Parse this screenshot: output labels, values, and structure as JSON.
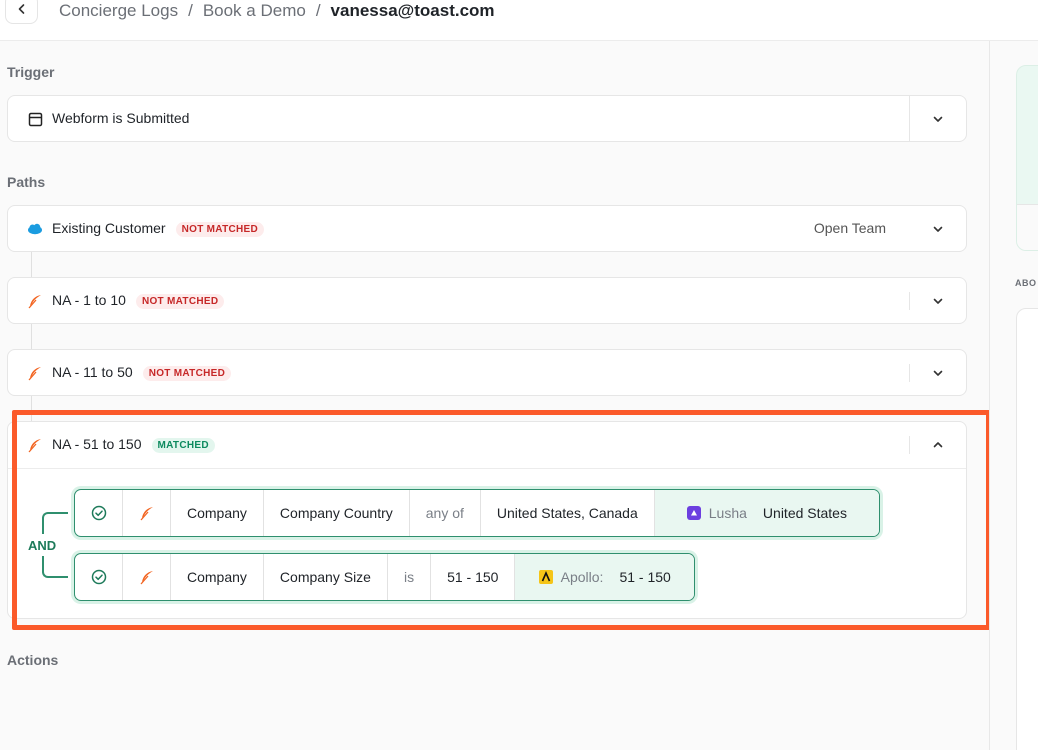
{
  "breadcrumb": {
    "items": [
      "Concierge Logs",
      "Book a Demo"
    ],
    "separator": "/",
    "current": "vanessa@toast.com"
  },
  "trigger": {
    "section_label": "Trigger",
    "title": "Webform is Submitted"
  },
  "paths": {
    "section_label": "Paths",
    "items": [
      {
        "title": "Existing Customer",
        "status": "NOT MATCHED",
        "action": "Open Team",
        "icon": "salesforce-cloud-icon"
      },
      {
        "title": "NA - 1 to 10",
        "status": "NOT MATCHED",
        "icon": "feather-icon"
      },
      {
        "title": "NA - 11 to 50",
        "status": "NOT MATCHED",
        "icon": "feather-icon"
      },
      {
        "title": "NA - 51 to 150",
        "status": "MATCHED",
        "icon": "feather-icon"
      }
    ]
  },
  "conditions": {
    "joiner": "AND",
    "rows": [
      {
        "object": "Company",
        "field": "Company Country",
        "operator": "any of",
        "value": "United States, Canada",
        "source_name": "Lusha",
        "source_value": "United States"
      },
      {
        "object": "Company",
        "field": "Company Size",
        "operator": "is",
        "value": "51 - 150",
        "source_name": "Apollo:",
        "source_value": "51 - 150"
      }
    ]
  },
  "actions": {
    "section_label": "Actions"
  },
  "right_panel": {
    "about_label": "ABO"
  },
  "colors": {
    "matched": "#0e8a5f",
    "not_matched": "#c62828",
    "highlight": "#fb5a2a",
    "condition_border": "#2f8f6e"
  }
}
